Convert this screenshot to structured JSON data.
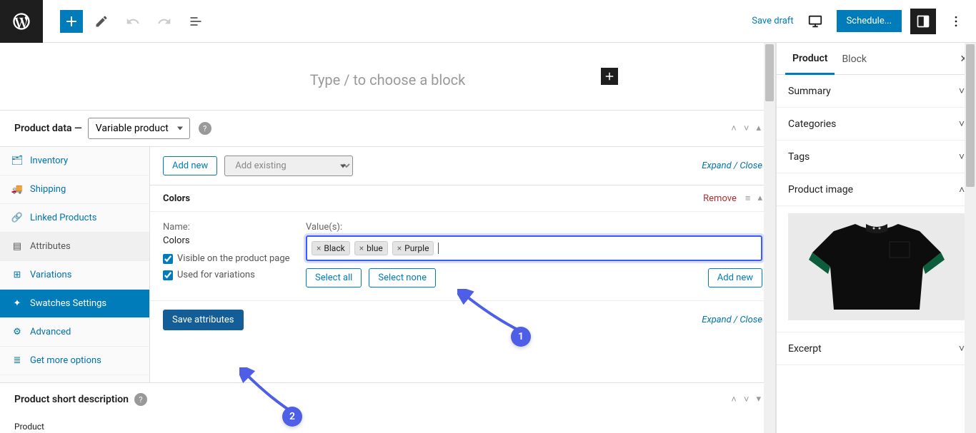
{
  "topbar": {
    "save_draft": "Save draft",
    "schedule": "Schedule..."
  },
  "editor": {
    "placeholder": "Type / to choose a block"
  },
  "product_data": {
    "label": "Product data —",
    "type_selected": "Variable product"
  },
  "pd_tabs": {
    "inventory": "Inventory",
    "shipping": "Shipping",
    "linked": "Linked Products",
    "attributes": "Attributes",
    "variations": "Variations",
    "swatches": "Swatches Settings",
    "advanced": "Advanced",
    "more": "Get more options"
  },
  "attributes": {
    "add_new": "Add new",
    "add_existing_placeholder": "Add existing",
    "expand_close": "Expand / Close",
    "attr_title": "Colors",
    "remove": "Remove",
    "name_label": "Name:",
    "name_value": "Colors",
    "visible_label": "Visible on the product page",
    "used_label": "Used for variations",
    "values_label": "Value(s):",
    "chips": [
      "Black",
      "blue",
      "Purple"
    ],
    "select_all": "Select all",
    "select_none": "Select none",
    "add_new_value": "Add new",
    "save_attributes": "Save attributes",
    "expand_close2": "Expand / Close"
  },
  "short_desc": {
    "title": "Product short description",
    "mini": "Product"
  },
  "sidebar": {
    "tab_product": "Product",
    "tab_block": "Block",
    "panels": {
      "summary": "Summary",
      "categories": "Categories",
      "tags": "Tags",
      "product_image": "Product image",
      "excerpt": "Excerpt"
    }
  },
  "callouts": {
    "one": "1",
    "two": "2"
  }
}
